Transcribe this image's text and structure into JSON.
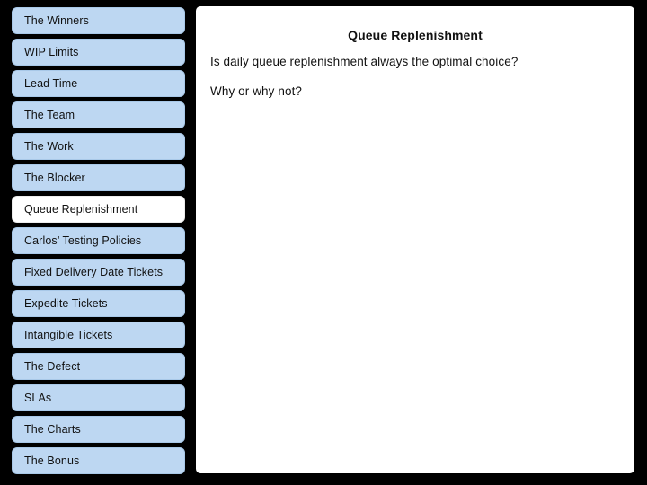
{
  "slide": {
    "background_color": "#000000",
    "panel_color": "#ffffff"
  },
  "sidebar": {
    "item_color": "#bdd7f2",
    "selected_item_color": "#ffffff",
    "items": [
      {
        "label": "The Winners",
        "selected": false
      },
      {
        "label": "WIP Limits",
        "selected": false
      },
      {
        "label": "Lead Time",
        "selected": false
      },
      {
        "label": "The Team",
        "selected": false
      },
      {
        "label": "The Work",
        "selected": false
      },
      {
        "label": "The Blocker",
        "selected": false
      },
      {
        "label": "Queue Replenishment",
        "selected": true
      },
      {
        "label": "Carlos’ Testing Policies",
        "selected": false
      },
      {
        "label": "Fixed Delivery Date Tickets",
        "selected": false
      },
      {
        "label": "Expedite Tickets",
        "selected": false
      },
      {
        "label": "Intangible Tickets",
        "selected": false
      },
      {
        "label": "The Defect",
        "selected": false
      },
      {
        "label": "SLAs",
        "selected": false
      },
      {
        "label": "The Charts",
        "selected": false
      },
      {
        "label": "The Bonus",
        "selected": false
      }
    ]
  },
  "content": {
    "title": "Queue Replenishment",
    "lines": [
      "Is daily queue replenishment always the optimal choice?",
      "Why or why not?"
    ]
  }
}
